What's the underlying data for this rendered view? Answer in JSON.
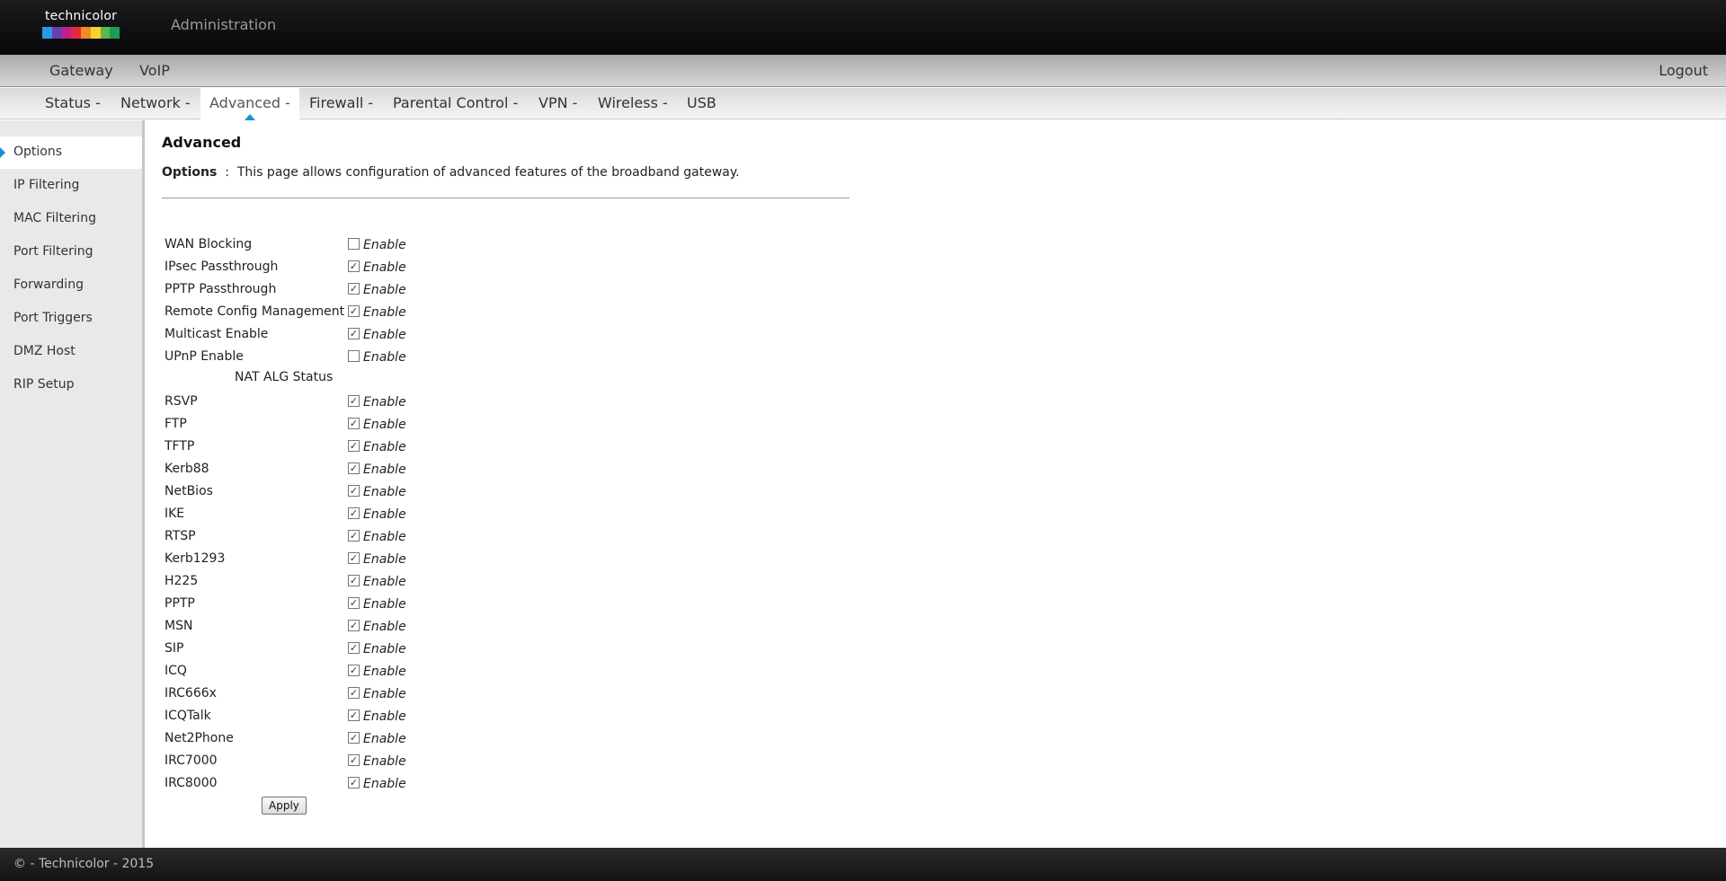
{
  "header": {
    "logo_text": "technicolor",
    "title": "Administration",
    "logo_colors": [
      "#2b9be0",
      "#6a3db3",
      "#c1208c",
      "#e6293f",
      "#f48a23",
      "#f8d12f",
      "#5cb848",
      "#1f9a5a"
    ]
  },
  "topnav": {
    "items": [
      "Gateway",
      "VoIP"
    ],
    "logout": "Logout"
  },
  "subnav": {
    "items": [
      "Status -",
      "Network -",
      "Advanced -",
      "Firewall -",
      "Parental Control -",
      "VPN -",
      "Wireless -",
      "USB"
    ],
    "active": "Advanced -"
  },
  "sidebar": {
    "items": [
      "Options",
      "IP Filtering",
      "MAC Filtering",
      "Port Filtering",
      "Forwarding",
      "Port Triggers",
      "DMZ Host",
      "RIP Setup"
    ],
    "active": "Options"
  },
  "content": {
    "title": "Advanced",
    "desc_label": "Options",
    "desc_sep": ":",
    "desc_text": "This page allows configuration of advanced features of the broadband gateway.",
    "enable_text": "Enable",
    "nat_label": "NAT ALG Status",
    "options": [
      {
        "label": "WAN Blocking",
        "checked": false
      },
      {
        "label": "IPsec Passthrough",
        "checked": true
      },
      {
        "label": "PPTP Passthrough",
        "checked": true
      },
      {
        "label": "Remote Config Management",
        "checked": true
      },
      {
        "label": "Multicast Enable",
        "checked": true
      },
      {
        "label": "UPnP Enable",
        "checked": false
      }
    ],
    "nat_options": [
      {
        "label": "RSVP",
        "checked": true
      },
      {
        "label": "FTP",
        "checked": true
      },
      {
        "label": "TFTP",
        "checked": true
      },
      {
        "label": "Kerb88",
        "checked": true
      },
      {
        "label": "NetBios",
        "checked": true
      },
      {
        "label": "IKE",
        "checked": true
      },
      {
        "label": "RTSP",
        "checked": true
      },
      {
        "label": "Kerb1293",
        "checked": true
      },
      {
        "label": "H225",
        "checked": true
      },
      {
        "label": "PPTP",
        "checked": true
      },
      {
        "label": "MSN",
        "checked": true
      },
      {
        "label": "SIP",
        "checked": true
      },
      {
        "label": "ICQ",
        "checked": true
      },
      {
        "label": "IRC666x",
        "checked": true
      },
      {
        "label": "ICQTalk",
        "checked": true
      },
      {
        "label": "Net2Phone",
        "checked": true
      },
      {
        "label": "IRC7000",
        "checked": true
      },
      {
        "label": "IRC8000",
        "checked": true
      }
    ],
    "apply_label": "Apply"
  },
  "footer": {
    "text": "© - Technicolor - 2015"
  }
}
